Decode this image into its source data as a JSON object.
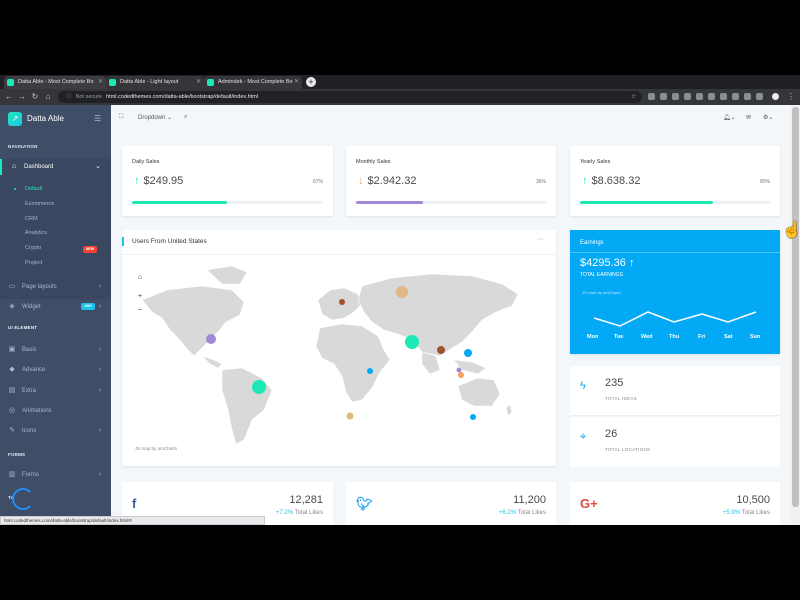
{
  "browser": {
    "tabs": [
      {
        "title": "Datta Able - Most Complete Bo"
      },
      {
        "title": "Datta Able - Light layout"
      },
      {
        "title": "Admindek - Most Complete Bo"
      }
    ],
    "not_secure": "Not secure",
    "url": "html.codedthemes.com/datta-able/bootstrap/default/index.html",
    "status_url": "html.codedthemes.com/datta-able/bootstrap/default/index.html#!"
  },
  "brand": {
    "name": "Datta Able"
  },
  "sidebar": {
    "nav_caption": "NAVIGATION",
    "dashboard": "Dashboard",
    "dashboard_sub": [
      "Default",
      "Ecommerce",
      "CRM",
      "Analytics",
      "Crypto",
      "Project"
    ],
    "new_badge": "NEW",
    "page_layouts": "Page layouts",
    "widget": "Widget",
    "widget_badge": "100+",
    "ui_caption": "UI ELEMENT",
    "ui_items": [
      "Basic",
      "Advance",
      "Extra",
      "Animations",
      "Icons"
    ],
    "forms_caption": "FORMS",
    "forms": "Forms",
    "tables_caption": "TA",
    "colors": {
      "bg": "#3f4d67",
      "accent": "#1de9b6"
    }
  },
  "navbar": {
    "dropdown": "Dropdown"
  },
  "sales": [
    {
      "title": "Daily Sales",
      "value": "$249.95",
      "percent": "67%",
      "progress": 0.5,
      "trend": "up",
      "color": "#1de9b6"
    },
    {
      "title": "Monthly Sales",
      "value": "$2.942.32",
      "percent": "36%",
      "progress": 0.35,
      "trend": "down",
      "color": "#a389d4"
    },
    {
      "title": "Yearly Sales",
      "value": "$8.638.32",
      "percent": "80%",
      "progress": 0.7,
      "trend": "up",
      "color": "#1de9b6"
    }
  ],
  "users_map": {
    "title": "Users From United States",
    "more": "···",
    "credit": "JS map by amCharts"
  },
  "earnings": {
    "title": "Earnings",
    "value": "$4295.36",
    "subtitle": "TOTAL EARNINGS",
    "credit": "JS chart by amCharts",
    "days": [
      "Mon",
      "Tue",
      "Wed",
      "Thu",
      "Fri",
      "Sat",
      "Sun"
    ],
    "bg": "#04a9f5"
  },
  "stats": [
    {
      "value": "235",
      "label": "TOTAL IDEAS",
      "icon": "bolt-icon"
    },
    {
      "value": "26",
      "label": "TOTAL LOCATIONS",
      "icon": "map-pin-icon"
    }
  ],
  "social": [
    {
      "network": "facebook",
      "value": "12,281",
      "change": "+7.2%",
      "label": "Total Likes",
      "color": "#3b5998"
    },
    {
      "network": "twitter",
      "value": "11,200",
      "change": "+6.2%",
      "label": "Total Likes",
      "color": "#1da1f2"
    },
    {
      "network": "google-plus",
      "value": "10,500",
      "change": "+5.9%",
      "label": "Total Likes",
      "color": "#dd4b39"
    }
  ]
}
